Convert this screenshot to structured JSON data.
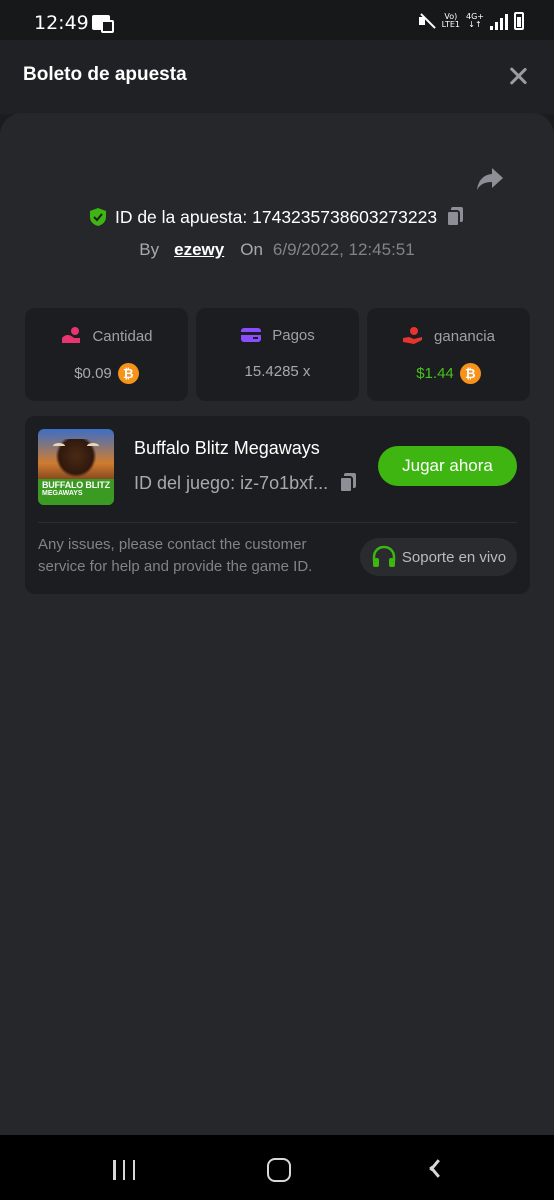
{
  "status_bar": {
    "time": "12:49",
    "volte_top": "Vo)",
    "volte_bottom": "LTE1",
    "network_top": "4G+",
    "network_bottom": "↓↑"
  },
  "header": {
    "title": "Boleto de apuesta"
  },
  "bet": {
    "id_label": "ID de la apuesta: 1743235738603273223",
    "by_label": "By",
    "user": "ezewy",
    "on_label": "On",
    "datetime": "6/9/2022, 12:45:51"
  },
  "stats": [
    {
      "label": "Cantidad",
      "value": "$0.09",
      "icon": "coins-icon",
      "currency_icon": "bitcoin-icon"
    },
    {
      "label": "Pagos",
      "value": "15.4285 x",
      "icon": "card-icon"
    },
    {
      "label": "ganancia",
      "value": "$1.44",
      "icon": "hand-coin-icon",
      "currency_icon": "bitcoin-icon"
    }
  ],
  "game": {
    "title": "Buffalo Blitz Megaways",
    "id_text": "ID del juego: iz-7o1bxf...",
    "thumb_line1": "BUFFALO BLITZ",
    "thumb_line2": "MEGAWAYS",
    "play_label": "Jugar ahora",
    "support_text": "Any issues, please contact the customer service for help and provide the game ID.",
    "support_label": "Soporte en vivo"
  },
  "colors": {
    "accent_green": "#3fb512",
    "win_green": "#45c31a",
    "bitcoin_orange": "#f7931a",
    "amount_pink": "#e9346f",
    "payout_purple": "#8a4dff",
    "profit_red": "#e8342f"
  }
}
